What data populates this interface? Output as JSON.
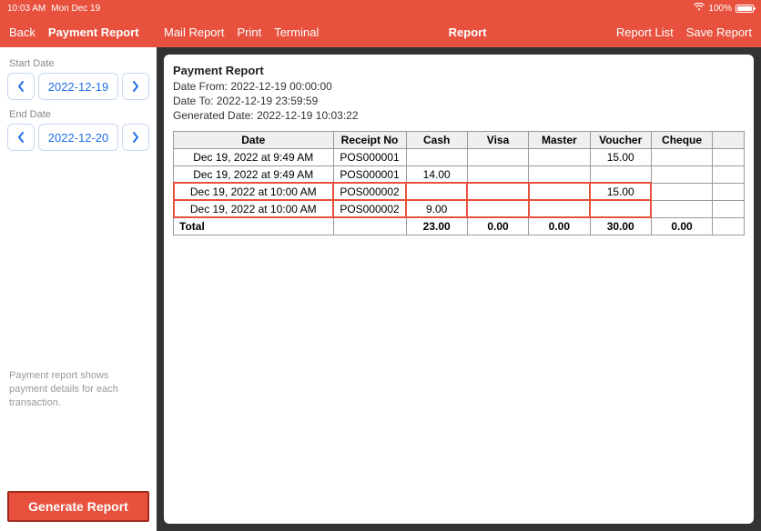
{
  "statusbar": {
    "time": "10:03 AM",
    "date": "Mon Dec 19",
    "battery_pct": "100%"
  },
  "navbar": {
    "back": "Back",
    "left_title": "Payment Report",
    "mail": "Mail Report",
    "print": "Print",
    "terminal": "Terminal",
    "center_title": "Report",
    "report_list": "Report List",
    "save_report": "Save Report"
  },
  "sidebar": {
    "start_label": "Start Date",
    "start_date": "2022-12-19",
    "end_label": "End Date",
    "end_date": "2022-12-20",
    "hint": "Payment report shows payment details for each transaction.",
    "generate": "Generate Report"
  },
  "report": {
    "title": "Payment Report",
    "date_from_label": "Date From:",
    "date_from": "2022-12-19 00:00:00",
    "date_to_label": "Date To:",
    "date_to": "2022-12-19 23:59:59",
    "generated_label": "Generated Date:",
    "generated": "2022-12-19 10:03:22",
    "columns": [
      "Date",
      "Receipt No",
      "Cash",
      "Visa",
      "Master",
      "Voucher",
      "Cheque",
      ""
    ],
    "rows": [
      {
        "date": "Dec 19, 2022 at 9:49 AM",
        "receipt": "POS000001",
        "cash": "",
        "visa": "",
        "master": "",
        "voucher": "15.00",
        "cheque": "",
        "highlight": false
      },
      {
        "date": "Dec 19, 2022 at 9:49 AM",
        "receipt": "POS000001",
        "cash": "14.00",
        "visa": "",
        "master": "",
        "voucher": "",
        "cheque": "",
        "highlight": false
      },
      {
        "date": "Dec 19, 2022 at 10:00 AM",
        "receipt": "POS000002",
        "cash": "",
        "visa": "",
        "master": "",
        "voucher": "15.00",
        "cheque": "",
        "highlight": true
      },
      {
        "date": "Dec 19, 2022 at 10:00 AM",
        "receipt": "POS000002",
        "cash": "9.00",
        "visa": "",
        "master": "",
        "voucher": "",
        "cheque": "",
        "highlight": true
      }
    ],
    "total_label": "Total",
    "totals": {
      "cash": "23.00",
      "visa": "0.00",
      "master": "0.00",
      "voucher": "30.00",
      "cheque": "0.00"
    }
  }
}
